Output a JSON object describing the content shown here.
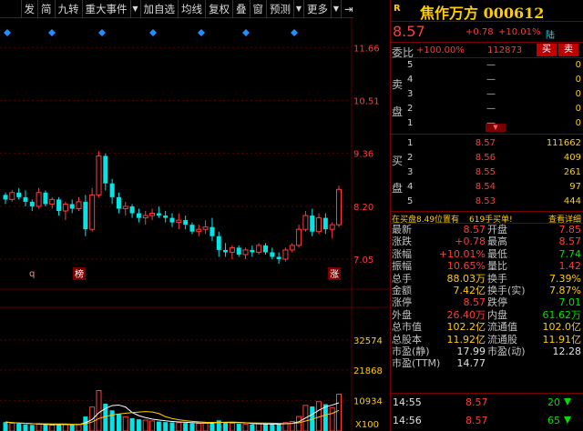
{
  "toolbar": {
    "items": [
      "发",
      "简",
      "九转",
      "重大事件",
      "加自选",
      "均线",
      "复权",
      "叠",
      "窗",
      "预测",
      "更多"
    ],
    "pin_glyph": "⇥"
  },
  "chart": {
    "price_axis": [
      "11.66",
      "10.51",
      "9.36",
      "8.20",
      "7.05"
    ],
    "volume_axis": [
      "32574",
      "21868",
      "10934"
    ],
    "volume_unit": "X100",
    "markers": {
      "q": "q",
      "bang": "榜",
      "zhang": "涨"
    },
    "colors": {
      "up": "#ff3b3b",
      "down": "#00e5e5",
      "ma1": "#ffffff",
      "ma2": "#ffcc00",
      "grid": "#5a0000"
    }
  },
  "chart_data": {
    "type": "candlestick",
    "price_range": [
      7.05,
      11.66
    ],
    "volume_range": [
      0,
      32574
    ],
    "note_values_estimated": true,
    "candles": [
      [
        8.45,
        8.5,
        8.25,
        8.35,
        0
      ],
      [
        8.35,
        8.55,
        8.3,
        8.5,
        1
      ],
      [
        8.5,
        8.6,
        8.35,
        8.4,
        0
      ],
      [
        8.4,
        8.55,
        8.2,
        8.3,
        0
      ],
      [
        8.3,
        8.35,
        8.1,
        8.2,
        0
      ],
      [
        8.2,
        8.6,
        8.15,
        8.5,
        1
      ],
      [
        8.5,
        8.55,
        8.2,
        8.25,
        0
      ],
      [
        8.25,
        8.4,
        8.15,
        8.35,
        1
      ],
      [
        8.35,
        8.4,
        8.0,
        8.1,
        0
      ],
      [
        8.1,
        8.3,
        7.9,
        8.25,
        1
      ],
      [
        8.25,
        8.35,
        8.05,
        8.15,
        0
      ],
      [
        8.15,
        8.4,
        8.1,
        8.3,
        1
      ],
      [
        8.3,
        8.45,
        7.55,
        7.7,
        0
      ],
      [
        7.7,
        8.6,
        7.65,
        8.45,
        1
      ],
      [
        8.45,
        9.4,
        8.4,
        9.3,
        1
      ],
      [
        9.3,
        9.35,
        8.55,
        8.7,
        0
      ],
      [
        8.7,
        8.8,
        8.25,
        8.4,
        0
      ],
      [
        8.4,
        8.5,
        8.05,
        8.15,
        0
      ],
      [
        8.15,
        8.3,
        8.0,
        8.2,
        1
      ],
      [
        8.2,
        8.25,
        7.95,
        8.05,
        0
      ],
      [
        8.05,
        8.15,
        7.85,
        7.95,
        0
      ],
      [
        7.95,
        8.1,
        7.8,
        8.0,
        1
      ],
      [
        8.0,
        8.15,
        7.9,
        8.05,
        1
      ],
      [
        8.05,
        8.2,
        7.95,
        8.0,
        0
      ],
      [
        8.0,
        8.1,
        7.85,
        7.95,
        0
      ],
      [
        7.95,
        8.05,
        7.75,
        7.85,
        0
      ],
      [
        7.85,
        8.05,
        7.7,
        7.9,
        1
      ],
      [
        7.9,
        8.0,
        7.7,
        7.8,
        0
      ],
      [
        7.8,
        7.85,
        7.6,
        7.65,
        0
      ],
      [
        7.65,
        7.8,
        7.55,
        7.7,
        1
      ],
      [
        7.7,
        7.9,
        7.6,
        7.75,
        1
      ],
      [
        7.75,
        7.95,
        7.45,
        7.55,
        0
      ],
      [
        7.55,
        7.65,
        7.1,
        7.25,
        0
      ],
      [
        7.25,
        7.4,
        7.1,
        7.2,
        0
      ],
      [
        7.2,
        7.35,
        7.05,
        7.3,
        1
      ],
      [
        7.3,
        7.35,
        7.1,
        7.15,
        0
      ],
      [
        7.15,
        7.3,
        7.05,
        7.25,
        1
      ],
      [
        7.25,
        7.35,
        7.1,
        7.2,
        0
      ],
      [
        7.2,
        7.4,
        7.15,
        7.35,
        1
      ],
      [
        7.35,
        7.4,
        7.15,
        7.2,
        0
      ],
      [
        7.2,
        7.3,
        7.05,
        7.1,
        0
      ],
      [
        7.1,
        7.2,
        6.95,
        7.05,
        0
      ],
      [
        7.05,
        7.3,
        7.0,
        7.25,
        1
      ],
      [
        7.25,
        7.4,
        7.2,
        7.35,
        1
      ],
      [
        7.35,
        7.8,
        7.3,
        7.7,
        1
      ],
      [
        7.7,
        8.1,
        7.65,
        8.0,
        1
      ],
      [
        8.0,
        8.15,
        7.55,
        7.65,
        0
      ],
      [
        7.65,
        8.05,
        7.6,
        7.95,
        1
      ],
      [
        7.95,
        8.05,
        7.6,
        7.7,
        0
      ],
      [
        7.7,
        7.85,
        7.5,
        7.8,
        1
      ],
      [
        7.8,
        8.65,
        7.75,
        8.57,
        1
      ]
    ],
    "volumes": [
      [
        3200,
        0
      ],
      [
        2800,
        1
      ],
      [
        2600,
        0
      ],
      [
        2400,
        0
      ],
      [
        2200,
        0
      ],
      [
        2500,
        1
      ],
      [
        2300,
        0
      ],
      [
        2100,
        1
      ],
      [
        2600,
        0
      ],
      [
        2400,
        1
      ],
      [
        2200,
        0
      ],
      [
        2300,
        1
      ],
      [
        5200,
        0
      ],
      [
        8600,
        1
      ],
      [
        14500,
        1
      ],
      [
        9800,
        0
      ],
      [
        7400,
        0
      ],
      [
        6200,
        0
      ],
      [
        5100,
        1
      ],
      [
        4600,
        0
      ],
      [
        4200,
        0
      ],
      [
        3900,
        1
      ],
      [
        3600,
        1
      ],
      [
        3400,
        0
      ],
      [
        3200,
        0
      ],
      [
        3100,
        0
      ],
      [
        3000,
        1
      ],
      [
        2900,
        0
      ],
      [
        2800,
        0
      ],
      [
        2700,
        1
      ],
      [
        2900,
        1
      ],
      [
        3200,
        0
      ],
      [
        3800,
        0
      ],
      [
        3100,
        0
      ],
      [
        2800,
        1
      ],
      [
        2600,
        0
      ],
      [
        2500,
        1
      ],
      [
        2400,
        0
      ],
      [
        2600,
        1
      ],
      [
        2500,
        0
      ],
      [
        2400,
        0
      ],
      [
        2600,
        0
      ],
      [
        3000,
        1
      ],
      [
        3400,
        1
      ],
      [
        5200,
        1
      ],
      [
        9200,
        1
      ],
      [
        8800,
        0
      ],
      [
        10500,
        1
      ],
      [
        9600,
        0
      ],
      [
        8400,
        1
      ],
      [
        13200,
        1
      ]
    ]
  },
  "quote": {
    "r_label": "R",
    "name": "焦作万方 000612",
    "price": "8.57",
    "change": "+0.78",
    "change_pct": "+10.01%",
    "market_tag": "陆",
    "weibi_label": "委比",
    "weibi_value": "+100.00%",
    "weibi_num": "112873",
    "buy_btn": "买",
    "sell_btn": "卖",
    "sell_side_label": [
      "卖",
      "盘"
    ],
    "buy_side_label": [
      "买",
      "盘"
    ],
    "drop_mark": "▼",
    "sell_book": [
      {
        "lvl": "5",
        "price": "—",
        "vol": "0"
      },
      {
        "lvl": "4",
        "price": "—",
        "vol": "0"
      },
      {
        "lvl": "3",
        "price": "—",
        "vol": "0"
      },
      {
        "lvl": "2",
        "price": "—",
        "vol": "0"
      },
      {
        "lvl": "1",
        "price": "—",
        "vol": "0"
      }
    ],
    "buy_book": [
      {
        "lvl": "1",
        "price": "8.57",
        "vol": "111662"
      },
      {
        "lvl": "2",
        "price": "8.56",
        "vol": "409"
      },
      {
        "lvl": "3",
        "price": "8.55",
        "vol": "261"
      },
      {
        "lvl": "4",
        "price": "8.54",
        "vol": "97"
      },
      {
        "lvl": "5",
        "price": "8.53",
        "vol": "444"
      }
    ],
    "status": {
      "a": "在买盘8.49位置有",
      "b": "619手",
      "c": "买单!",
      "d": "查看详细"
    },
    "stats": [
      {
        "l1": "最新",
        "v1": "8.57",
        "c1": "red",
        "l2": "开盘",
        "v2": "7.85",
        "c2": "red"
      },
      {
        "l1": "涨跌",
        "v1": "+0.78",
        "c1": "red",
        "l2": "最高",
        "v2": "8.57",
        "c2": "red"
      },
      {
        "l1": "涨幅",
        "v1": "+10.01%",
        "c1": "red",
        "l2": "最低",
        "v2": "7.74",
        "c2": "green"
      },
      {
        "l1": "振幅",
        "v1": "10.65%",
        "c1": "red",
        "l2": "量比",
        "v2": "1.42",
        "c2": "red"
      },
      {
        "l1": "总手",
        "v1": "88.03万",
        "c1": "yellow",
        "l2": "换手",
        "v2": "7.39%",
        "c2": "yellow"
      },
      {
        "l1": "金额",
        "v1": "7.42亿",
        "c1": "yellow",
        "l2": "换手(实)",
        "v2": "7.87%",
        "c2": "yellow"
      },
      {
        "l1": "涨停",
        "v1": "8.57",
        "c1": "red",
        "l2": "跌停",
        "v2": "7.01",
        "c2": "green"
      },
      {
        "l1": "外盘",
        "v1": "26.40万",
        "c1": "red",
        "l2": "内盘",
        "v2": "61.62万",
        "c2": "green"
      },
      {
        "l1": "总市值",
        "v1": "102.2亿",
        "c1": "yellow",
        "l2": "流通值",
        "v2": "102.0亿",
        "c2": "yellow"
      },
      {
        "l1": "总股本",
        "v1": "11.92亿",
        "c1": "yellow",
        "l2": "流通股",
        "v2": "11.91亿",
        "c2": "yellow"
      },
      {
        "l1": "市盈(静)",
        "v1": "17.99",
        "c1": "white",
        "l2": "市盈(动)",
        "v2": "12.28",
        "c2": "white"
      },
      {
        "l1": "市盈(TTM)",
        "v1": "14.77",
        "c1": "white",
        "l2": "",
        "v2": "",
        "c2": "white"
      }
    ],
    "ticks": [
      {
        "time": "14:55",
        "price": "8.57",
        "vol": "20"
      },
      {
        "time": "14:56",
        "price": "8.57",
        "vol": "65"
      }
    ]
  }
}
